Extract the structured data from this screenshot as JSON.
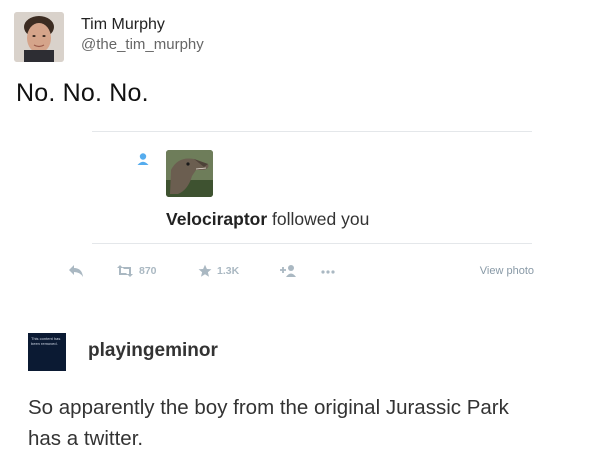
{
  "tweet": {
    "author_name": "Tim Murphy",
    "author_handle": "@the_tim_murphy",
    "text": "No. No. No."
  },
  "notification": {
    "actor": "Velociraptor",
    "action": " followed you"
  },
  "actions": {
    "retweet_count": "870",
    "like_count": "1.3K",
    "view_photo_label": "View photo"
  },
  "post": {
    "removed_notice": "This content has been removed.",
    "blog_name": "playingeminor",
    "text_line1": "So apparently the boy from the original Jurassic Park",
    "text_line2": "has a twitter."
  },
  "colors": {
    "icon_blue": "#55acee",
    "icon_gray": "#aab8c2",
    "divider": "#e4e7ea",
    "removed_box": "#0b1a33"
  }
}
